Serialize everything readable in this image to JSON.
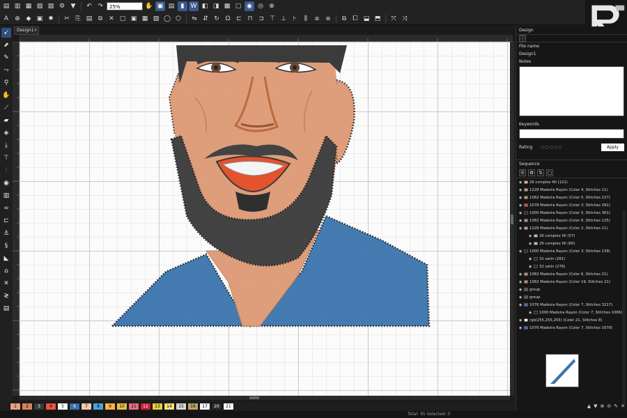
{
  "toolbar": {
    "zoom_value": "25%"
  },
  "document": {
    "tab_label": "Design1",
    "close_glyph": "✕"
  },
  "right_panel": {
    "title": "Design",
    "file_name_label": "File name",
    "file_name_value": "Design1",
    "notes_label": "Notes",
    "keywords_label": "Keywords",
    "rating_label": "Rating",
    "rating_stars": "○○○○○",
    "apply_label": "Apply",
    "sequence_label": "Sequence"
  },
  "sequence": [
    {
      "text": "26 complex fill (121)",
      "color": "#e8b59a",
      "level": 0
    },
    {
      "text": "1228 Madeira Rayon (Color 4, Stitches 11)",
      "color": "#d89878",
      "level": 0
    },
    {
      "text": "1082 Madeira Rayon (Color 5, Stitches 227)",
      "color": "#c88a6a",
      "level": 0
    },
    {
      "text": "1078 Madeira Rayon (Color 3, Stitches 391)",
      "color": "#e44a2a",
      "level": 0
    },
    {
      "text": "1000 Madeira Rayon (Color 5, Stitches 361)",
      "color": "#222222",
      "level": 0
    },
    {
      "text": "1082 Madeira Rayon (Color 6, Stitches 125)",
      "color": "#c88a6a",
      "level": 0
    },
    {
      "text": "1228 Madeira Rayon (Color 2, Stitches 11)",
      "color": "#d89878",
      "level": 0
    },
    {
      "text": "26 complex fill (57)",
      "color": "#e8b59a",
      "level": 1
    },
    {
      "text": "26 complex fill (60)",
      "color": "#e8b59a",
      "level": 1
    },
    {
      "text": "1000 Madeira Rayon (Color 3, Stitches 139)",
      "color": "#222222",
      "level": 0
    },
    {
      "text": "31 satin (261)",
      "color": "#222222",
      "level": 1
    },
    {
      "text": "32 satin (278)",
      "color": "#222222",
      "level": 1
    },
    {
      "text": "1082 Madeira Rayon (Color 6, Stitches 21)",
      "color": "#c88a6a",
      "level": 0
    },
    {
      "text": "1082 Madeira Rayon (Color 19, Stitches 21)",
      "color": "#c88a6a",
      "level": 0
    },
    {
      "text": "group",
      "color": "#555555",
      "level": 0
    },
    {
      "text": "group",
      "color": "#555555",
      "level": 0
    },
    {
      "text": "1076 Madeira Rayon (Color 7, Stitches 3217)",
      "color": "#3a6fb0",
      "level": 0
    },
    {
      "text": "1000 Madeira Rayon (Color 7, Stitches 1066)",
      "color": "#222222",
      "level": 1
    },
    {
      "text": "rgb(255,255,255) (Color 21, Stitches 8)",
      "color": "#ffffff",
      "level": 0
    },
    {
      "text": "1076 Madeira Rayon (Color 7, Stitches 1678)",
      "color": "#3a6fb0",
      "level": 0
    }
  ],
  "palette": [
    {
      "label": "1",
      "color": "#e9a27b"
    },
    {
      "label": "2",
      "color": "#d4845e"
    },
    {
      "label": "3",
      "color": "#3a3a3a"
    },
    {
      "label": "4",
      "color": "#e8583a"
    },
    {
      "label": "5",
      "color": "#ffffff"
    },
    {
      "label": "6",
      "color": "#3a6fb0"
    },
    {
      "label": "7",
      "color": "#f5c9a8"
    },
    {
      "label": "8",
      "color": "#4aa3e0"
    },
    {
      "label": "9",
      "color": "#ffb347"
    },
    {
      "label": "10",
      "color": "#e8c050"
    },
    {
      "label": "11",
      "color": "#e46a8a"
    },
    {
      "label": "12",
      "color": "#cc2233"
    },
    {
      "label": "13",
      "color": "#e8d040"
    },
    {
      "label": "14",
      "color": "#f2e27a"
    },
    {
      "label": "15",
      "color": "#d9d9d9"
    },
    {
      "label": "16",
      "color": "#bfa36a"
    },
    {
      "label": "17",
      "color": "#f4f4f4"
    },
    {
      "label": "20",
      "color": "#2a2a2a"
    },
    {
      "label": "21",
      "color": "#ffffff"
    }
  ],
  "statusbar": {
    "text": "Total: 45 Selected: 0"
  },
  "colors": {
    "skin": "#e2a27f",
    "beard": "#3b3b3b",
    "shirt": "#3f76ad",
    "lips": "#e4532e",
    "accent": "#3a5a8c"
  }
}
